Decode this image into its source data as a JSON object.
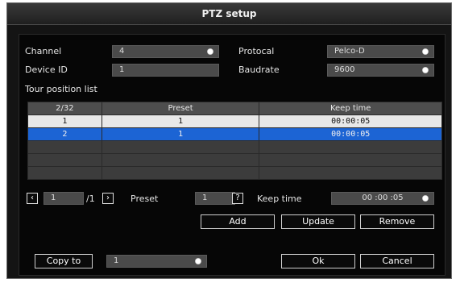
{
  "window": {
    "title": "PTZ setup"
  },
  "form": {
    "channel_label": "Channel",
    "channel_value": "4",
    "device_id_label": "Device ID",
    "device_id_value": "1",
    "protocol_label": "Protocal",
    "protocol_value": "Pelco-D",
    "baudrate_label": "Baudrate",
    "baudrate_value": "9600"
  },
  "tour": {
    "section_label": "Tour position list",
    "columns": [
      "2/32",
      "Preset",
      "Keep time"
    ],
    "rows": [
      [
        "1",
        "1",
        "00:00:05"
      ],
      [
        "2",
        "1",
        "00:00:05"
      ],
      [
        "",
        "",
        ""
      ],
      [
        "",
        "",
        ""
      ],
      [
        "",
        "",
        ""
      ]
    ]
  },
  "pager": {
    "prev_icon": "chevron-left-icon",
    "next_icon": "chevron-right-icon",
    "page_value": "1",
    "page_total": "/1"
  },
  "preset_edit": {
    "preset_label": "Preset",
    "preset_value": "1",
    "help_glyph": "?",
    "keep_time_label": "Keep time",
    "keep_time_value": "00 :00 :05"
  },
  "actions": {
    "add_label": "Add",
    "update_label": "Update",
    "remove_label": "Remove"
  },
  "footer": {
    "copy_to_label": "Copy to",
    "copy_to_value": "1",
    "ok_label": "Ok",
    "cancel_label": "Cancel"
  },
  "colors": {
    "selected_row_blue": "#1c64d4",
    "selected_row_white": "#e8e8e8",
    "field_bg": "#4a4a4a"
  }
}
